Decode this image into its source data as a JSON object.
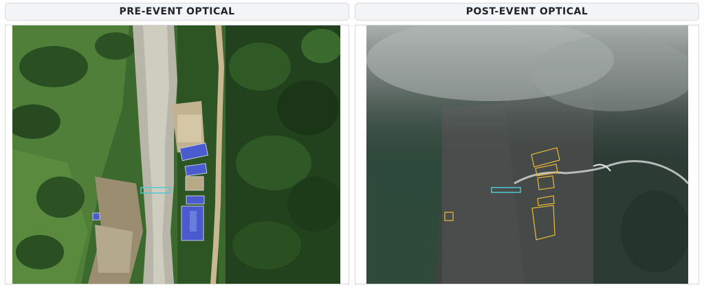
{
  "panels": {
    "pre": {
      "title": "PRE-EVENT OPTICAL"
    },
    "post": {
      "title": "POST-EVENT OPTICAL"
    }
  },
  "colors": {
    "header_bg": "#f3f4f6",
    "header_border": "#d6d9de",
    "building_pre": "#4a5bd0",
    "bridge_marker": "#4ec9d0",
    "building_outline_post": "#e2b43a"
  },
  "icons": {
    "pre_image": "satellite-image-pre-event",
    "post_image": "satellite-image-post-event"
  }
}
